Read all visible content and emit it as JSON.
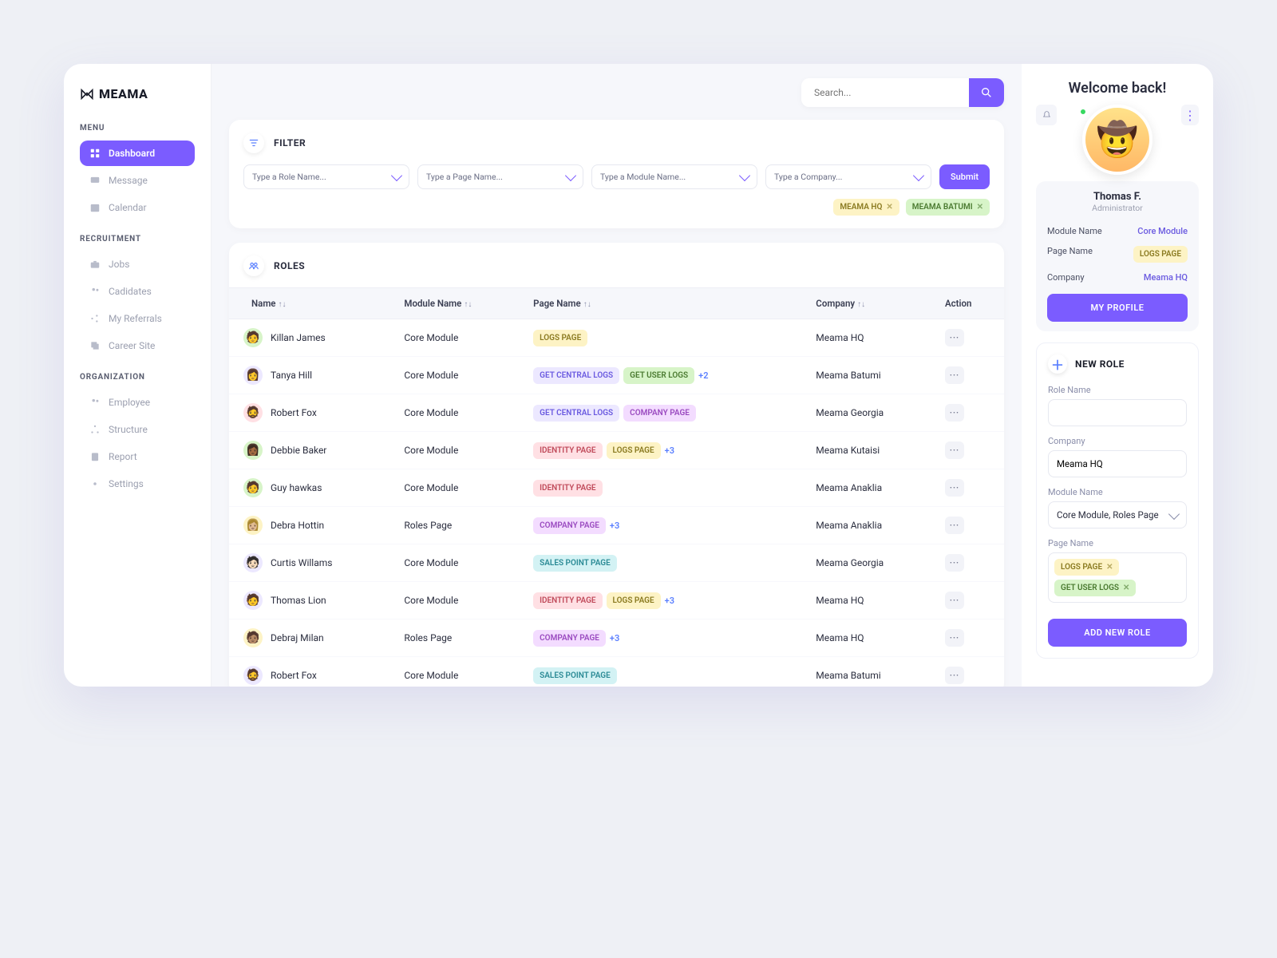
{
  "brand": "MEAMA",
  "search": {
    "placeholder": "Search..."
  },
  "sidebar": {
    "groups": [
      {
        "title": "MENU",
        "items": [
          {
            "label": "Dashboard",
            "active": true,
            "icon": "grid"
          },
          {
            "label": "Message",
            "icon": "message"
          },
          {
            "label": "Calendar",
            "icon": "calendar"
          }
        ]
      },
      {
        "title": "RECRUITMENT",
        "items": [
          {
            "label": "Jobs",
            "icon": "briefcase"
          },
          {
            "label": "Cadidates",
            "icon": "users"
          },
          {
            "label": "My Referrals",
            "icon": "share"
          },
          {
            "label": "Career Site",
            "icon": "copy"
          }
        ]
      },
      {
        "title": "ORGANIZATION",
        "items": [
          {
            "label": "Employee",
            "icon": "users"
          },
          {
            "label": "Structure",
            "icon": "tree"
          },
          {
            "label": "Report",
            "icon": "clipboard"
          },
          {
            "label": "Settings",
            "icon": "gear"
          }
        ]
      }
    ]
  },
  "filter": {
    "title": "FILTER",
    "role": "Type a Role Name...",
    "page": "Type a Page Name...",
    "module": "Type a Module Name...",
    "company": "Type a Company...",
    "submit": "Submit",
    "chips": [
      {
        "label": "MEAMA HQ",
        "cls": "yellow"
      },
      {
        "label": "MEAMA BATUMI",
        "cls": "green"
      }
    ]
  },
  "roles": {
    "title": "ROLES",
    "columns": {
      "name": "Name",
      "module": "Module Name",
      "page": "Page Name",
      "company": "Company",
      "action": "Action"
    },
    "rows": [
      {
        "name": "Killan James",
        "avbg": "#d7f4c8",
        "module": "Core Module",
        "pages": [
          {
            "l": "LOGS PAGE",
            "c": "yellow"
          }
        ],
        "more": "",
        "company": "Meama HQ"
      },
      {
        "name": "Tanya Hill",
        "avbg": "#ece8ff",
        "module": "Core Module",
        "pages": [
          {
            "l": "GET CENTRAL LOGS",
            "c": "lav"
          },
          {
            "l": "GET USER LOGS",
            "c": "green"
          }
        ],
        "more": "+2",
        "company": "Meama Batumi"
      },
      {
        "name": "Robert Fox",
        "avbg": "#ffe0e4",
        "module": "Core Module",
        "pages": [
          {
            "l": "GET CENTRAL LOGS",
            "c": "lav"
          },
          {
            "l": "COMPANY PAGE",
            "c": "mag"
          }
        ],
        "more": "",
        "company": "Meama Georgia"
      },
      {
        "name": "Debbie Baker",
        "avbg": "#d7f4c8",
        "module": "Core Module",
        "pages": [
          {
            "l": "IDENTITY PAGE",
            "c": "pink"
          },
          {
            "l": "LOGS PAGE",
            "c": "yellow"
          }
        ],
        "more": "+3",
        "company": "Meama Kutaisi"
      },
      {
        "name": "Guy hawkas",
        "avbg": "#d7f4c8",
        "module": "Core Module",
        "pages": [
          {
            "l": "IDENTITY PAGE",
            "c": "pink"
          }
        ],
        "more": "",
        "company": "Meama Anaklia"
      },
      {
        "name": "Debra Hottin",
        "avbg": "#fdf3c5",
        "module": "Roles Page",
        "pages": [
          {
            "l": "COMPANY PAGE",
            "c": "mag"
          }
        ],
        "more": "+3",
        "company": "Meama Anaklia"
      },
      {
        "name": "Curtis Willams",
        "avbg": "#ece8ff",
        "module": "Core Module",
        "pages": [
          {
            "l": "SALES POINT PAGE",
            "c": "teal"
          }
        ],
        "more": "",
        "company": "Meama Georgia"
      },
      {
        "name": "Thomas Lion",
        "avbg": "#ece8ff",
        "module": "Core Module",
        "pages": [
          {
            "l": "IDENTITY PAGE",
            "c": "pink"
          },
          {
            "l": "LOGS PAGE",
            "c": "yellow"
          }
        ],
        "more": "+3",
        "company": "Meama HQ"
      },
      {
        "name": "Debraj Milan",
        "avbg": "#fdf3c5",
        "module": "Roles Page",
        "pages": [
          {
            "l": "COMPANY PAGE",
            "c": "mag"
          }
        ],
        "more": "+3",
        "company": "Meama HQ"
      },
      {
        "name": "Robert Fox",
        "avbg": "#ece8ff",
        "module": "Core Module",
        "pages": [
          {
            "l": "SALES POINT PAGE",
            "c": "teal"
          }
        ],
        "more": "",
        "company": "Meama Batumi"
      }
    ]
  },
  "right": {
    "welcome": "Welcome back!",
    "user": {
      "name": "Thomas F.",
      "role": "Administrator"
    },
    "info": {
      "module": {
        "k": "Module Name",
        "v": "Core Module"
      },
      "page": {
        "k": "Page Name",
        "v": "LOGS PAGE"
      },
      "company": {
        "k": "Company",
        "v": "Meama HQ"
      }
    },
    "profile_btn": "MY PROFILE",
    "newrole": {
      "title": "NEW ROLE",
      "role_lbl": "Role Name",
      "company_lbl": "Company",
      "company_val": "Meama HQ",
      "module_lbl": "Module Name",
      "module_val": "Core Module, Roles Page",
      "page_lbl": "Page Name",
      "page_chips": [
        {
          "l": "LOGS PAGE",
          "c": "yellow"
        },
        {
          "l": "GET USER LOGS",
          "c": "green"
        }
      ],
      "submit": "ADD NEW ROLE"
    }
  }
}
